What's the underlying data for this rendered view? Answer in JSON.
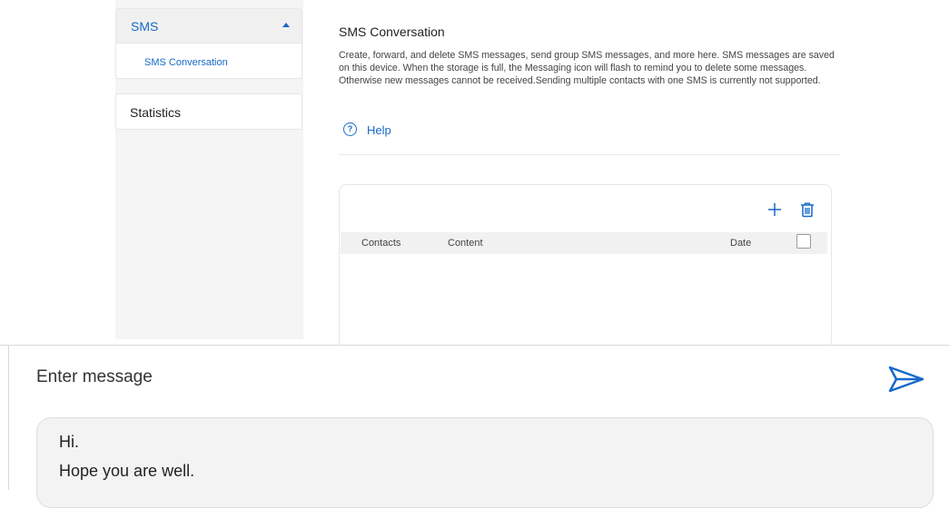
{
  "sidebar": {
    "sms_label": "SMS",
    "sms_sub_item": "SMS Conversation",
    "statistics_label": "Statistics"
  },
  "main": {
    "title": "SMS Conversation",
    "description": "Create, forward, and delete SMS messages, send group SMS messages, and more here. SMS messages are saved on this device. When the storage is full, the Messaging icon will flash to remind you to delete some messages. Otherwise new messages cannot be received.Sending multiple contacts with one SMS is currently not supported.",
    "help_label": "Help",
    "table": {
      "columns": [
        "Contacts",
        "Content",
        "Date"
      ],
      "rows": []
    }
  },
  "compose": {
    "title": "Enter message",
    "message_lines": [
      "Hi.",
      "Hope you are well."
    ]
  },
  "colors": {
    "accent": "#1769c9",
    "sidebar_bg": "#f5f5f5",
    "message_box_bg": "#f3f3f3"
  },
  "icons": {
    "sms_toggle": "caret-up-icon",
    "help": "help-circle-icon",
    "add": "plus-icon",
    "delete": "trash-icon",
    "send": "send-icon"
  }
}
